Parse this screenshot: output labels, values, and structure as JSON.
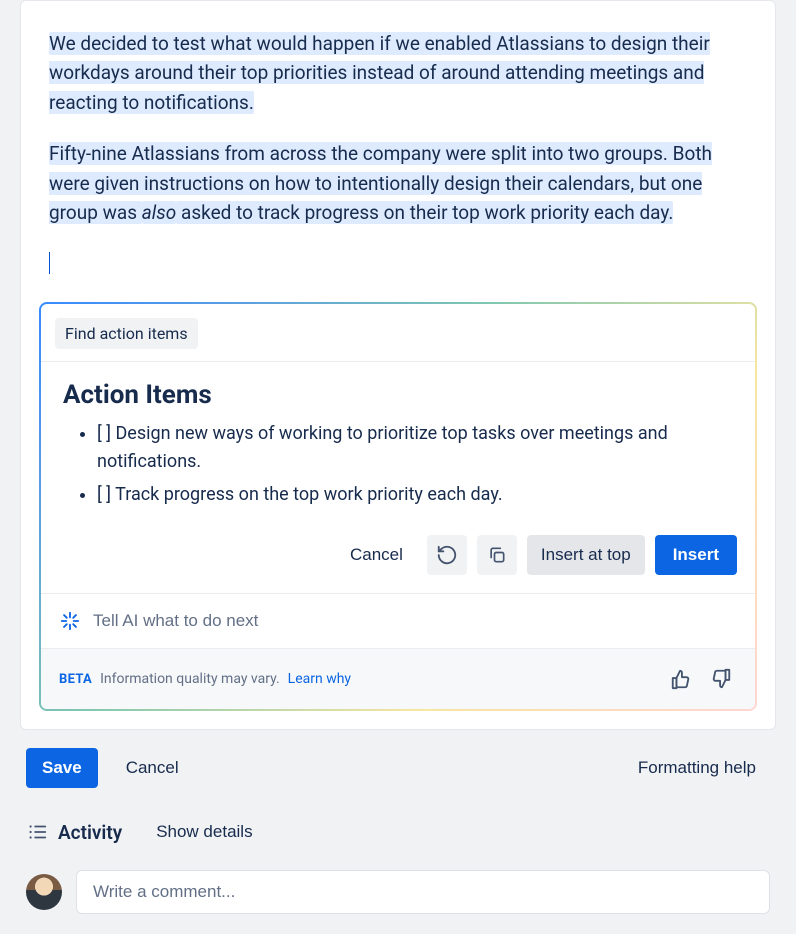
{
  "document": {
    "paragraph1_a": "We decided to test what would happen if we enabled Atlassians to design their workdays around their top priorities instead of around attending meetings and reacting to notifications.",
    "paragraph2_a": "Fifty-nine Atlassians from across the company were split into two groups. Both were given instructions on how to intentionally design their calendars, but one group was ",
    "paragraph2_em": "also",
    "paragraph2_b": " asked to track progress on their top work priority each day."
  },
  "ai": {
    "chip": "Find action items",
    "heading": "Action Items",
    "items": [
      "[ ] Design new ways of working to prioritize top tasks over meetings and notifications.",
      "[ ] Track progress on the top work priority each day."
    ],
    "actions": {
      "cancel": "Cancel",
      "insert_top": "Insert at top",
      "insert": "Insert"
    },
    "prompt_placeholder": "Tell AI what to do next",
    "footer": {
      "beta": "BETA",
      "quality": "Information quality may vary.",
      "learn": "Learn why"
    }
  },
  "editor_actions": {
    "save": "Save",
    "cancel": "Cancel",
    "formatting_help": "Formatting help"
  },
  "activity": {
    "title": "Activity",
    "show_details": "Show details",
    "comment_placeholder": "Write a comment..."
  }
}
